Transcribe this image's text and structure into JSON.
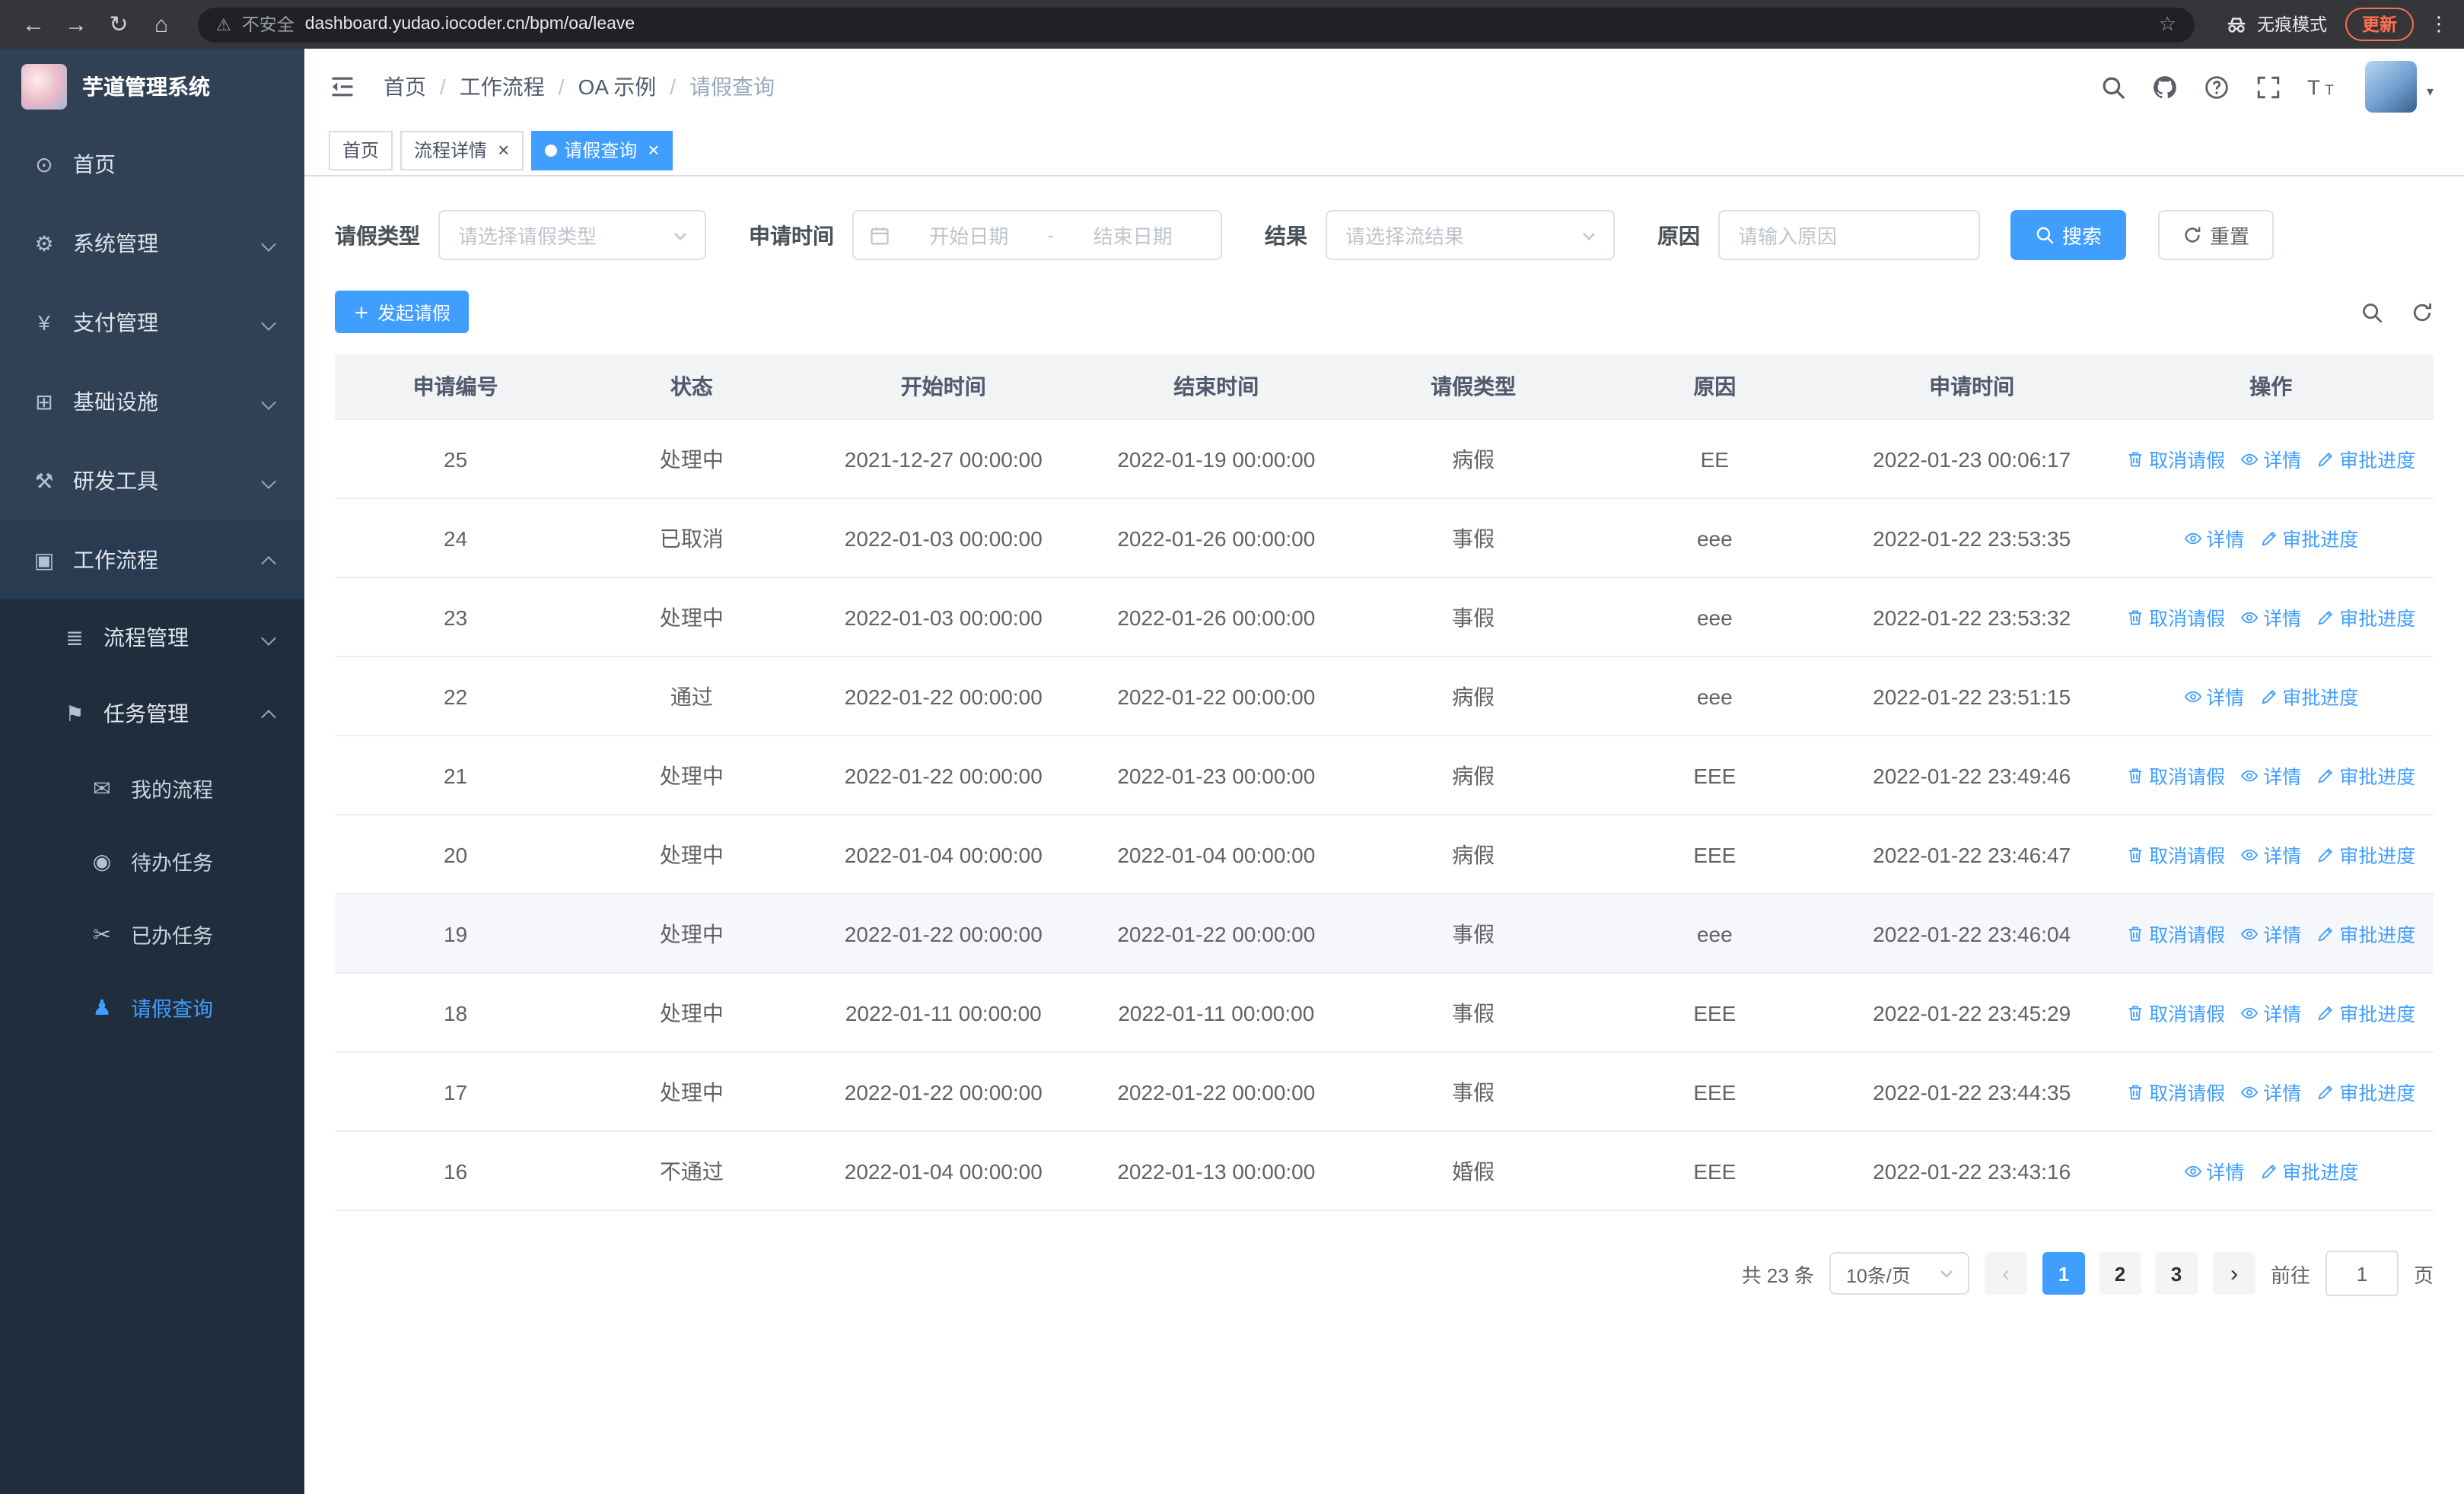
{
  "colors": {
    "accent": "#409eff",
    "sidebar_bg": "#304156",
    "sidebar_submenu_bg": "#1f2d3d",
    "chrome_bg": "#35363a",
    "update_accent": "#ff6e50",
    "table_header_bg": "#f2f3f5"
  },
  "browser": {
    "url": "dashboard.yudao.iocoder.cn/bpm/oa/leave",
    "security_label": "不安全",
    "incognito_label": "无痕模式",
    "update_label": "更新"
  },
  "sidebar": {
    "logo_title": "芋道管理系统",
    "items": [
      {
        "key": "home",
        "label": "首页",
        "icon": "dashboard-icon",
        "level": 0
      },
      {
        "key": "system-management",
        "label": "系统管理",
        "icon": "gear-icon",
        "level": 0,
        "arrow": "down"
      },
      {
        "key": "payment-management",
        "label": "支付管理",
        "icon": "yen-icon",
        "level": 0,
        "arrow": "down"
      },
      {
        "key": "infrastructure",
        "label": "基础设施",
        "icon": "infrastructure-icon",
        "level": 0,
        "arrow": "down"
      },
      {
        "key": "dev-tools",
        "label": "研发工具",
        "icon": "tools-icon",
        "level": 0,
        "arrow": "down"
      },
      {
        "key": "workflow",
        "label": "工作流程",
        "icon": "briefcase-icon",
        "level": 0,
        "arrow": "up",
        "open": true
      },
      {
        "key": "process-management",
        "label": "流程管理",
        "icon": "list-icon",
        "level": 1,
        "arrow": "down"
      },
      {
        "key": "task-management",
        "label": "任务管理",
        "icon": "flag-icon",
        "level": 1,
        "arrow": "up",
        "open": true
      },
      {
        "key": "my-process",
        "label": "我的流程",
        "icon": "chat-icon",
        "level": 2
      },
      {
        "key": "todo-tasks",
        "label": "待办任务",
        "icon": "eye-icon",
        "level": 2
      },
      {
        "key": "done-tasks",
        "label": "已办任务",
        "icon": "scissors-icon",
        "level": 2
      },
      {
        "key": "leave-query",
        "label": "请假查询",
        "icon": "user-icon",
        "level": 2,
        "active": true
      }
    ]
  },
  "breadcrumb": [
    "首页",
    "工作流程",
    "OA 示例",
    "请假查询"
  ],
  "tabs": [
    {
      "key": "home",
      "label": "首页",
      "active": false,
      "closable": false
    },
    {
      "key": "process-detail",
      "label": "流程详情",
      "active": false,
      "closable": true
    },
    {
      "key": "leave-query",
      "label": "请假查询",
      "active": true,
      "closable": true
    }
  ],
  "filters": {
    "leave_type_label": "请假类型",
    "leave_type_placeholder": "请选择请假类型",
    "apply_time_label": "申请时间",
    "start_date_placeholder": "开始日期",
    "date_separator": "-",
    "end_date_placeholder": "结束日期",
    "result_label": "结果",
    "result_placeholder": "请选择流结果",
    "reason_label": "原因",
    "reason_placeholder": "请输入原因",
    "search_label": "搜索",
    "reset_label": "重置"
  },
  "toolbar": {
    "create_label": "发起请假"
  },
  "table": {
    "columns": [
      "申请编号",
      "状态",
      "开始时间",
      "结束时间",
      "请假类型",
      "原因",
      "申请时间",
      "操作"
    ],
    "actions": {
      "cancel": "取消请假",
      "detail": "详情",
      "progress": "审批进度"
    },
    "rows": [
      {
        "id": "25",
        "status": "处理中",
        "start": "2021-12-27 00:00:00",
        "end": "2022-01-19 00:00:00",
        "type": "病假",
        "reason": "EE",
        "applied": "2022-01-23 00:06:17",
        "cancelable": true
      },
      {
        "id": "24",
        "status": "已取消",
        "start": "2022-01-03 00:00:00",
        "end": "2022-01-26 00:00:00",
        "type": "事假",
        "reason": "eee",
        "applied": "2022-01-22 23:53:35",
        "cancelable": false
      },
      {
        "id": "23",
        "status": "处理中",
        "start": "2022-01-03 00:00:00",
        "end": "2022-01-26 00:00:00",
        "type": "事假",
        "reason": "eee",
        "applied": "2022-01-22 23:53:32",
        "cancelable": true
      },
      {
        "id": "22",
        "status": "通过",
        "start": "2022-01-22 00:00:00",
        "end": "2022-01-22 00:00:00",
        "type": "病假",
        "reason": "eee",
        "applied": "2022-01-22 23:51:15",
        "cancelable": false
      },
      {
        "id": "21",
        "status": "处理中",
        "start": "2022-01-22 00:00:00",
        "end": "2022-01-23 00:00:00",
        "type": "病假",
        "reason": "EEE",
        "applied": "2022-01-22 23:49:46",
        "cancelable": true
      },
      {
        "id": "20",
        "status": "处理中",
        "start": "2022-01-04 00:00:00",
        "end": "2022-01-04 00:00:00",
        "type": "病假",
        "reason": "EEE",
        "applied": "2022-01-22 23:46:47",
        "cancelable": true
      },
      {
        "id": "19",
        "status": "处理中",
        "start": "2022-01-22 00:00:00",
        "end": "2022-01-22 00:00:00",
        "type": "事假",
        "reason": "eee",
        "applied": "2022-01-22 23:46:04",
        "cancelable": true,
        "highlighted": true
      },
      {
        "id": "18",
        "status": "处理中",
        "start": "2022-01-11 00:00:00",
        "end": "2022-01-11 00:00:00",
        "type": "事假",
        "reason": "EEE",
        "applied": "2022-01-22 23:45:29",
        "cancelable": true
      },
      {
        "id": "17",
        "status": "处理中",
        "start": "2022-01-22 00:00:00",
        "end": "2022-01-22 00:00:00",
        "type": "事假",
        "reason": "EEE",
        "applied": "2022-01-22 23:44:35",
        "cancelable": true
      },
      {
        "id": "16",
        "status": "不通过",
        "start": "2022-01-04 00:00:00",
        "end": "2022-01-13 00:00:00",
        "type": "婚假",
        "reason": "EEE",
        "applied": "2022-01-22 23:43:16",
        "cancelable": false
      }
    ]
  },
  "pagination": {
    "total_label": "共 23 条",
    "page_size": "10条/页",
    "pages": [
      "1",
      "2",
      "3"
    ],
    "active_page": "1",
    "goto_label": "前往",
    "goto_value": "1",
    "page_unit": "页"
  }
}
